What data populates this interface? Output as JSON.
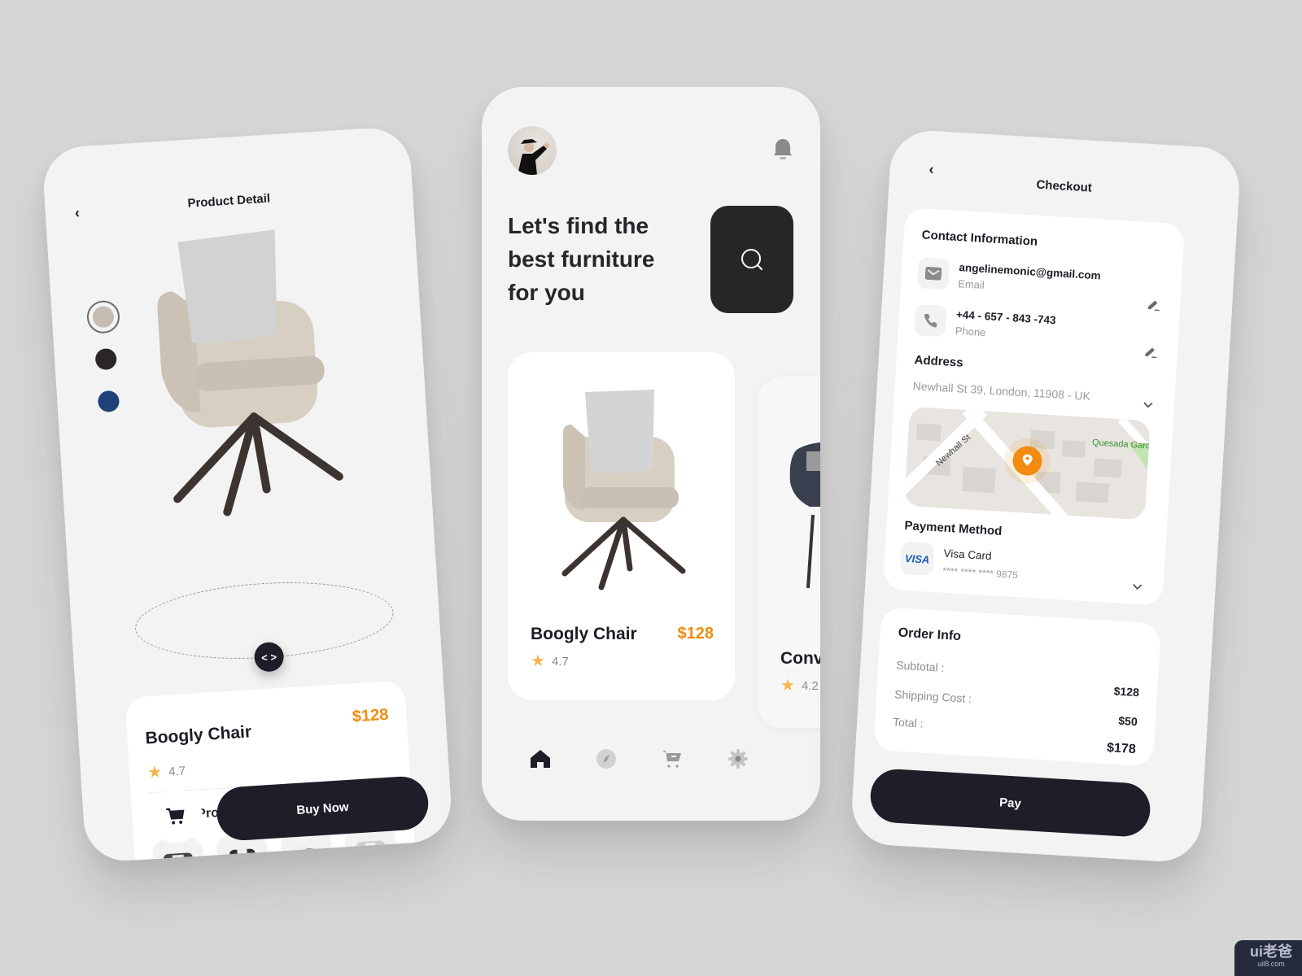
{
  "product_detail": {
    "title": "Product Detail",
    "color_options": [
      {
        "name": "beige",
        "hex": "#c5bbb1",
        "selected": true
      },
      {
        "name": "black",
        "hex": "#2c2726",
        "selected": false
      },
      {
        "name": "navy",
        "hex": "#1e4277",
        "selected": false
      }
    ],
    "rotate_icon": "< >",
    "product_name": "Boogly Chair",
    "price": "$128",
    "rating": "4.7",
    "similar_title": "Similar Products",
    "similar_products": [
      "dark armchair",
      "patterned chair",
      "swivel lounge chair",
      "tufted loveseat"
    ],
    "cart_icon": "cart-icon",
    "buy_label": "Buy Now"
  },
  "home": {
    "headline_lines": [
      "Let's find the",
      "best furniture",
      "for you"
    ],
    "search_icon": "search-icon",
    "bell_icon": "bell-icon",
    "products": [
      {
        "name": "Boogly Chair",
        "price": "$128",
        "rating": "4.7"
      },
      {
        "name": "Conv",
        "rating": "4.2"
      }
    ],
    "nav": [
      {
        "name": "home",
        "active": true
      },
      {
        "name": "explore",
        "active": false
      },
      {
        "name": "cart",
        "active": false
      },
      {
        "name": "settings",
        "active": false
      }
    ]
  },
  "checkout": {
    "title": "Checkout",
    "contact_title": "Contact Information",
    "email": {
      "value": "angelinemonic@gmail.com",
      "label": "Email"
    },
    "phone": {
      "value": "+44 - 657 - 843 -743",
      "label": "Phone"
    },
    "address_title": "Address",
    "address": "Newhall St 39, London, 11908 - UK",
    "map_labels": {
      "street": "Newhall St",
      "park": "Quesada Gard"
    },
    "payment_title": "Payment Method",
    "card_brand": "VISA",
    "card_name": "Visa Card",
    "card_number": "****  ****  ****  9875",
    "order_title": "Order Info",
    "subtotal_label": "Subtotal :",
    "subtotal": "$128",
    "shipping_label": "Shipping Cost :",
    "shipping": "$50",
    "total_label": "Total :",
    "total": "$178",
    "pay_label": "Pay"
  },
  "watermark": {
    "brand": "ui老爸",
    "url": "uil8.com"
  },
  "colors": {
    "accent": "#f28b10",
    "dark": "#1d1e28",
    "star": "#f7b54b"
  }
}
